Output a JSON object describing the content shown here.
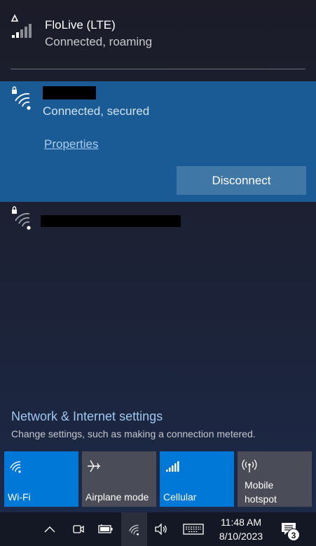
{
  "cellular": {
    "name": "FloLive (LTE)",
    "status": "Connected, roaming"
  },
  "wifi_connected": {
    "status": "Connected, secured",
    "properties_label": "Properties",
    "disconnect_label": "Disconnect"
  },
  "settings": {
    "title": "Network & Internet settings",
    "description": "Change settings, such as making a connection metered."
  },
  "tiles": [
    {
      "label": "Wi-Fi",
      "active": true,
      "icon": "wifi-icon"
    },
    {
      "label": "Airplane mode",
      "active": false,
      "icon": "airplane-icon"
    },
    {
      "label": "Cellular",
      "active": true,
      "icon": "cellular-signal-icon"
    },
    {
      "label_line1": "Mobile",
      "label_line2": "hotspot",
      "active": false,
      "icon": "hotspot-icon"
    }
  ],
  "taskbar": {
    "time": "11:48 AM",
    "date": "8/10/2023",
    "notification_count": "3"
  },
  "colors": {
    "selected_network_bg": "#1a5b95",
    "tile_active": "#0078d7",
    "tile_inactive": "#4a4d57",
    "link": "#9fc7ef"
  }
}
